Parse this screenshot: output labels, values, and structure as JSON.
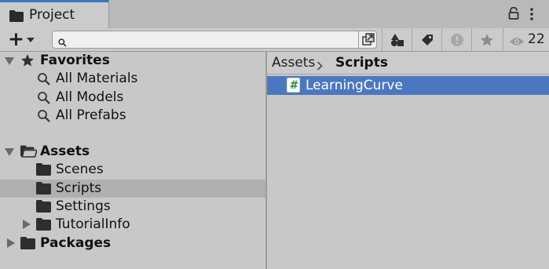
{
  "window": {
    "tab_title": "Project",
    "visible_count": "22"
  },
  "toolbar": {
    "create_label": "+",
    "search_placeholder": "",
    "search_value": ""
  },
  "tree": {
    "favorites": {
      "label": "Favorites",
      "items": [
        {
          "label": "All Materials"
        },
        {
          "label": "All Models"
        },
        {
          "label": "All Prefabs"
        }
      ]
    },
    "assets": {
      "label": "Assets",
      "items": [
        {
          "label": "Scenes",
          "selected": false
        },
        {
          "label": "Scripts",
          "selected": true
        },
        {
          "label": "Settings",
          "selected": false
        },
        {
          "label": "TutorialInfo",
          "selected": false
        }
      ]
    },
    "packages": {
      "label": "Packages"
    }
  },
  "content": {
    "breadcrumb": [
      "Assets",
      "Scripts"
    ],
    "assets": [
      {
        "label": "LearningCurve",
        "type": "csharp-script-icon",
        "selected": true
      }
    ]
  },
  "colors": {
    "selection_blue": "#4b77c0",
    "tab_accent": "#3a79bf",
    "tree_selected": "#b0b0b0",
    "script_hash": "#2f8b2f"
  }
}
